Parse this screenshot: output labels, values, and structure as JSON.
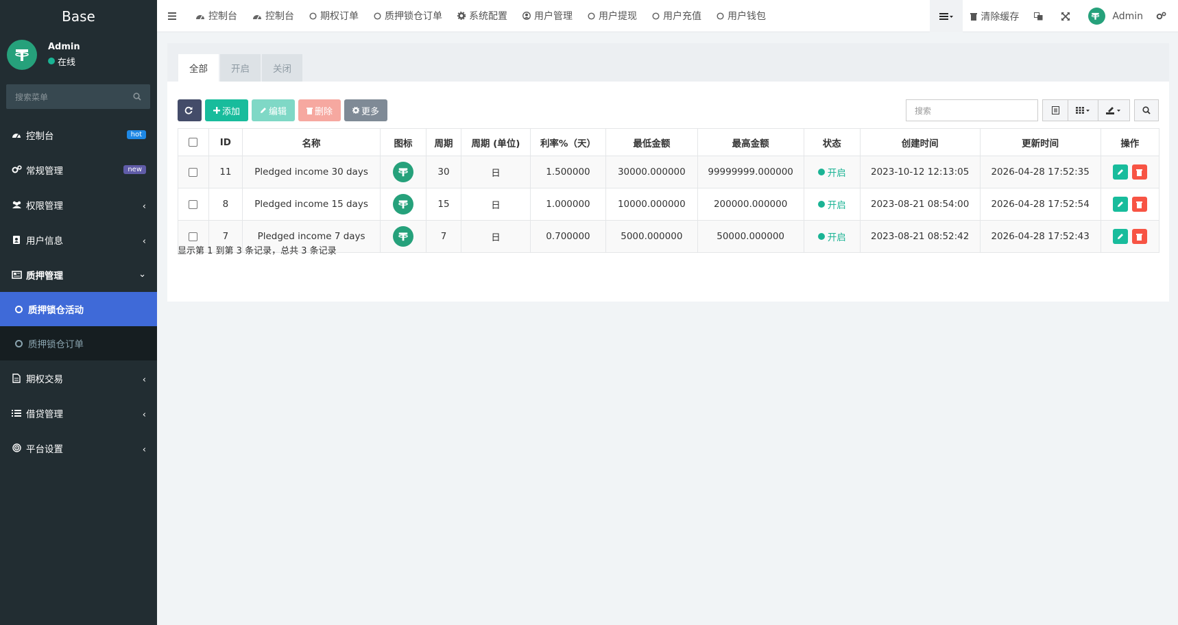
{
  "sidebar": {
    "logo": "Base",
    "user": {
      "name": "Admin",
      "status": "在线"
    },
    "search_placeholder": "搜索菜单",
    "menu": [
      {
        "label": "控制台",
        "badge": "hot",
        "badge_color": "#1e88e5"
      },
      {
        "label": "常规管理",
        "badge": "new",
        "badge_color": "#605ca8"
      },
      {
        "label": "权限管理"
      },
      {
        "label": "用户信息"
      },
      {
        "label": "质押管理",
        "expanded": true
      },
      {
        "label": "期权交易"
      },
      {
        "label": "借贷管理"
      },
      {
        "label": "平台设置"
      }
    ],
    "submenu": [
      {
        "label": "质押锁仓活动",
        "active": true
      },
      {
        "label": "质押锁仓订单",
        "active": false
      }
    ]
  },
  "topnav": {
    "items": [
      "控制台",
      "控制台",
      "期权订单",
      "质押锁仓订单",
      "系统配置",
      "用户管理",
      "用户提现",
      "用户充值",
      "用户钱包"
    ],
    "clear_cache": "清除缓存",
    "admin": "Admin"
  },
  "tabs": [
    "全部",
    "开启",
    "关闭"
  ],
  "toolbar": {
    "add": "添加",
    "edit": "编辑",
    "delete": "删除",
    "more": "更多",
    "search_placeholder": "搜索"
  },
  "table": {
    "headers": [
      "ID",
      "名称",
      "图标",
      "周期",
      "周期 (单位)",
      "利率%（天）",
      "最低金额",
      "最高金额",
      "状态",
      "创建时间",
      "更新时间",
      "操作"
    ],
    "rows": [
      {
        "id": "11",
        "name": "Pledged income 30 days",
        "period": "30",
        "unit": "日",
        "rate": "1.500000",
        "min": "30000.000000",
        "max": "99999999.000000",
        "status": "开启",
        "created": "2023-10-12 12:13:05",
        "updated": "2026-04-28 17:52:35"
      },
      {
        "id": "8",
        "name": "Pledged income 15 days",
        "period": "15",
        "unit": "日",
        "rate": "1.000000",
        "min": "10000.000000",
        "max": "200000.000000",
        "status": "开启",
        "created": "2023-08-21 08:54:00",
        "updated": "2026-04-28 17:52:54"
      },
      {
        "id": "7",
        "name": "Pledged income 7 days",
        "period": "7",
        "unit": "日",
        "rate": "0.700000",
        "min": "5000.000000",
        "max": "50000.000000",
        "status": "开启",
        "created": "2023-08-21 08:52:42",
        "updated": "2026-04-28 17:52:43"
      }
    ]
  },
  "pager_info": "显示第 1 到第 3 条记录，总共 3 条记录",
  "colors": {
    "sidebar_bg": "#222d32",
    "active_menu": "#3f6ad8",
    "tether": "#26a17b",
    "success": "#1ab394",
    "danger": "#f75444"
  }
}
